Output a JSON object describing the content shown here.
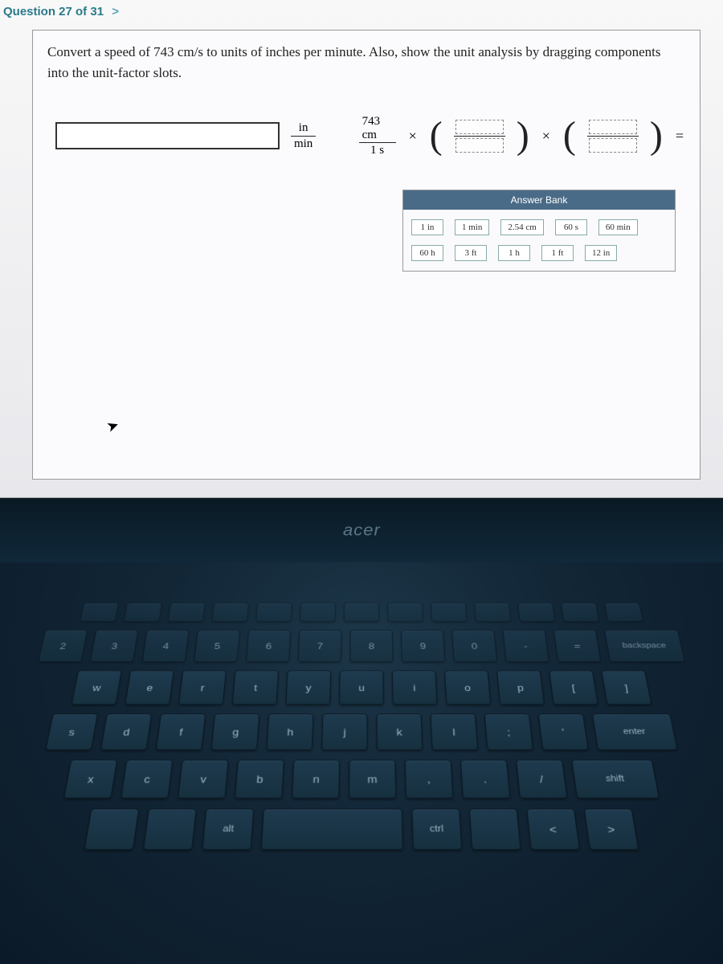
{
  "header": {
    "question_label": "Question 27 of 31",
    "chevron": ">"
  },
  "prompt": "Convert a speed of 743 cm/s to units of inches per minute. Also, show the unit analysis by dragging components into the unit-factor slots.",
  "equation": {
    "result_unit_top": "in",
    "result_unit_bot": "min",
    "given_top": "743 cm",
    "given_bot": "1 s",
    "times": "×",
    "equals": "="
  },
  "answer_bank": {
    "title": "Answer Bank",
    "items": [
      "1 in",
      "1 min",
      "2.54 cm",
      "60 s",
      "60 min",
      "60 h",
      "3 ft",
      "1 h",
      "1 ft",
      "12 in"
    ]
  },
  "brand": "acer",
  "keyboard": {
    "row0": [
      "",
      "",
      "",
      "",
      "",
      "",
      "",
      "",
      "",
      "",
      "",
      "",
      ""
    ],
    "row1": [
      "2",
      "3",
      "4",
      "5",
      "6",
      "7",
      "8",
      "9",
      "0",
      "-",
      "=",
      "backspace"
    ],
    "row2": [
      "w",
      "e",
      "r",
      "t",
      "y",
      "u",
      "i",
      "o",
      "p",
      "[",
      "]"
    ],
    "row3": [
      "s",
      "d",
      "f",
      "g",
      "h",
      "j",
      "k",
      "l",
      ";",
      "'",
      "enter"
    ],
    "row4": [
      "x",
      "c",
      "v",
      "b",
      "n",
      "m",
      ",",
      ".",
      "/",
      "shift"
    ],
    "row5": [
      "",
      "",
      "alt",
      "",
      "ctrl",
      "",
      "<",
      ">"
    ]
  }
}
